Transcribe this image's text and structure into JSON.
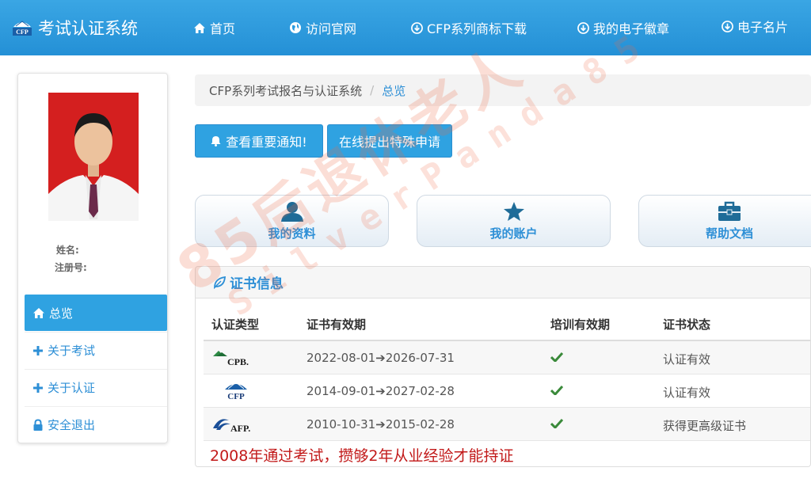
{
  "app": {
    "title": "考试认证系统",
    "logo_text": "CFP"
  },
  "nav": [
    {
      "label": "首页",
      "icon": "home-icon"
    },
    {
      "label": "访问官网",
      "icon": "globe-icon"
    },
    {
      "label": "CFP系列商标下载",
      "icon": "download-icon"
    },
    {
      "label": "我的电子徽章",
      "icon": "download-icon"
    },
    {
      "label": "电子名片",
      "icon": "download-icon"
    }
  ],
  "profile": {
    "name_label": "姓名:",
    "reg_label": "注册号:"
  },
  "sidebar": [
    {
      "label": "总览",
      "icon": "home-icon",
      "active": true
    },
    {
      "label": "关于考试",
      "icon": "plus-icon"
    },
    {
      "label": "关于认证",
      "icon": "plus-icon"
    },
    {
      "label": "安全退出",
      "icon": "lock-icon"
    }
  ],
  "breadcrumb": {
    "root": "CFP系列考试报名与认证系统",
    "separator": "/",
    "current": "总览"
  },
  "buttons": {
    "notice": "查看重要通知!",
    "special": "在线提出特殊申请"
  },
  "tiles": [
    {
      "label": "我的资料",
      "icon": "user-icon"
    },
    {
      "label": "我的账户",
      "icon": "star-icon"
    },
    {
      "label": "帮助文档",
      "icon": "briefcase-icon"
    }
  ],
  "cert_panel": {
    "title": "证书信息",
    "columns": [
      "认证类型",
      "证书有效期",
      "培训有效期",
      "证书状态"
    ],
    "rows": [
      {
        "type_logo": "CPB.",
        "validity": "2022-08-01➔2026-07-31",
        "training_ok": true,
        "status": "认证有效"
      },
      {
        "type_logo": "CFP",
        "validity": "2014-09-01➔2027-02-28",
        "training_ok": true,
        "status": "认证有效"
      },
      {
        "type_logo": "AFP.",
        "validity": "2010-10-31➔2015-02-28",
        "training_ok": true,
        "status": "获得更高级证书"
      }
    ],
    "note": "2008年通过考试，攒够2年从业经验才能持证"
  },
  "watermark": {
    "line1": "85后退休老人",
    "line2": "SilverPanda85"
  },
  "colors": {
    "nav_bg": "#2b9be0",
    "accent": "#2d8fd6",
    "check": "#3a8a3a",
    "note": "#c21a1a"
  }
}
